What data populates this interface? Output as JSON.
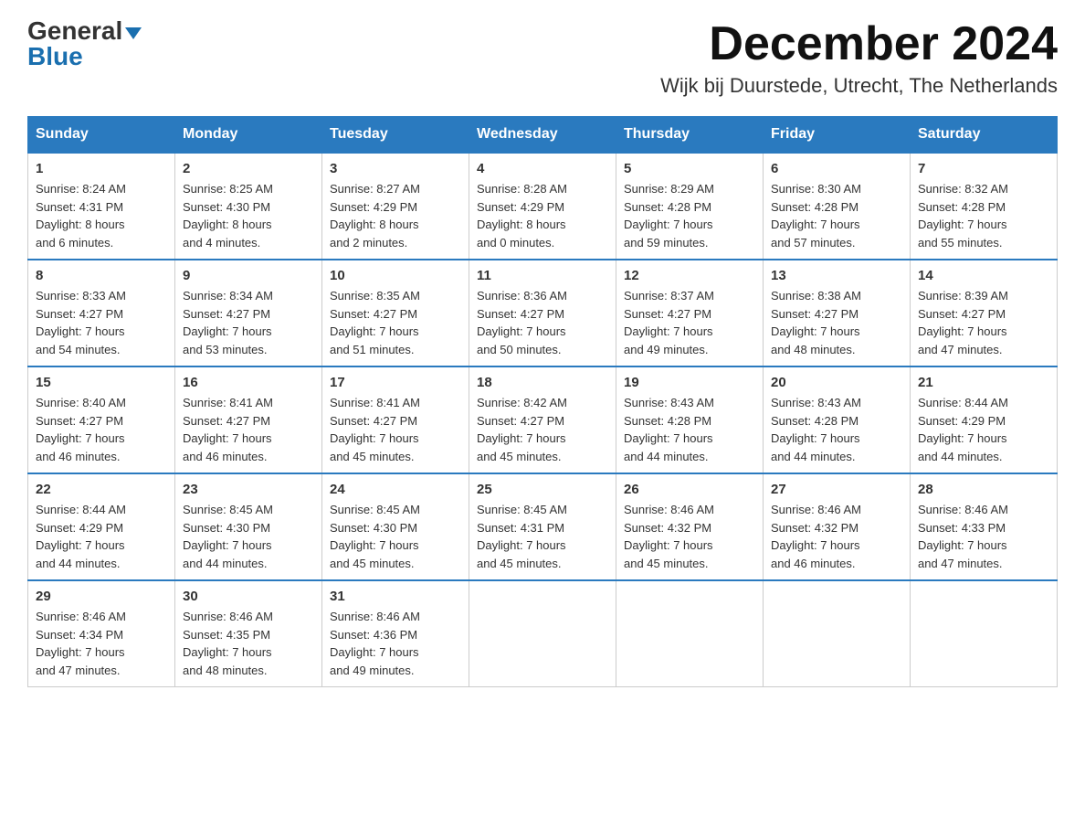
{
  "logo": {
    "general": "General",
    "blue": "Blue"
  },
  "header": {
    "month_year": "December 2024",
    "location": "Wijk bij Duurstede, Utrecht, The Netherlands"
  },
  "weekdays": [
    "Sunday",
    "Monday",
    "Tuesday",
    "Wednesday",
    "Thursday",
    "Friday",
    "Saturday"
  ],
  "weeks": [
    [
      {
        "day": "1",
        "sunrise": "8:24 AM",
        "sunset": "4:31 PM",
        "daylight": "8 hours and 6 minutes."
      },
      {
        "day": "2",
        "sunrise": "8:25 AM",
        "sunset": "4:30 PM",
        "daylight": "8 hours and 4 minutes."
      },
      {
        "day": "3",
        "sunrise": "8:27 AM",
        "sunset": "4:29 PM",
        "daylight": "8 hours and 2 minutes."
      },
      {
        "day": "4",
        "sunrise": "8:28 AM",
        "sunset": "4:29 PM",
        "daylight": "8 hours and 0 minutes."
      },
      {
        "day": "5",
        "sunrise": "8:29 AM",
        "sunset": "4:28 PM",
        "daylight": "7 hours and 59 minutes."
      },
      {
        "day": "6",
        "sunrise": "8:30 AM",
        "sunset": "4:28 PM",
        "daylight": "7 hours and 57 minutes."
      },
      {
        "day": "7",
        "sunrise": "8:32 AM",
        "sunset": "4:28 PM",
        "daylight": "7 hours and 55 minutes."
      }
    ],
    [
      {
        "day": "8",
        "sunrise": "8:33 AM",
        "sunset": "4:27 PM",
        "daylight": "7 hours and 54 minutes."
      },
      {
        "day": "9",
        "sunrise": "8:34 AM",
        "sunset": "4:27 PM",
        "daylight": "7 hours and 53 minutes."
      },
      {
        "day": "10",
        "sunrise": "8:35 AM",
        "sunset": "4:27 PM",
        "daylight": "7 hours and 51 minutes."
      },
      {
        "day": "11",
        "sunrise": "8:36 AM",
        "sunset": "4:27 PM",
        "daylight": "7 hours and 50 minutes."
      },
      {
        "day": "12",
        "sunrise": "8:37 AM",
        "sunset": "4:27 PM",
        "daylight": "7 hours and 49 minutes."
      },
      {
        "day": "13",
        "sunrise": "8:38 AM",
        "sunset": "4:27 PM",
        "daylight": "7 hours and 48 minutes."
      },
      {
        "day": "14",
        "sunrise": "8:39 AM",
        "sunset": "4:27 PM",
        "daylight": "7 hours and 47 minutes."
      }
    ],
    [
      {
        "day": "15",
        "sunrise": "8:40 AM",
        "sunset": "4:27 PM",
        "daylight": "7 hours and 46 minutes."
      },
      {
        "day": "16",
        "sunrise": "8:41 AM",
        "sunset": "4:27 PM",
        "daylight": "7 hours and 46 minutes."
      },
      {
        "day": "17",
        "sunrise": "8:41 AM",
        "sunset": "4:27 PM",
        "daylight": "7 hours and 45 minutes."
      },
      {
        "day": "18",
        "sunrise": "8:42 AM",
        "sunset": "4:27 PM",
        "daylight": "7 hours and 45 minutes."
      },
      {
        "day": "19",
        "sunrise": "8:43 AM",
        "sunset": "4:28 PM",
        "daylight": "7 hours and 44 minutes."
      },
      {
        "day": "20",
        "sunrise": "8:43 AM",
        "sunset": "4:28 PM",
        "daylight": "7 hours and 44 minutes."
      },
      {
        "day": "21",
        "sunrise": "8:44 AM",
        "sunset": "4:29 PM",
        "daylight": "7 hours and 44 minutes."
      }
    ],
    [
      {
        "day": "22",
        "sunrise": "8:44 AM",
        "sunset": "4:29 PM",
        "daylight": "7 hours and 44 minutes."
      },
      {
        "day": "23",
        "sunrise": "8:45 AM",
        "sunset": "4:30 PM",
        "daylight": "7 hours and 44 minutes."
      },
      {
        "day": "24",
        "sunrise": "8:45 AM",
        "sunset": "4:30 PM",
        "daylight": "7 hours and 45 minutes."
      },
      {
        "day": "25",
        "sunrise": "8:45 AM",
        "sunset": "4:31 PM",
        "daylight": "7 hours and 45 minutes."
      },
      {
        "day": "26",
        "sunrise": "8:46 AM",
        "sunset": "4:32 PM",
        "daylight": "7 hours and 45 minutes."
      },
      {
        "day": "27",
        "sunrise": "8:46 AM",
        "sunset": "4:32 PM",
        "daylight": "7 hours and 46 minutes."
      },
      {
        "day": "28",
        "sunrise": "8:46 AM",
        "sunset": "4:33 PM",
        "daylight": "7 hours and 47 minutes."
      }
    ],
    [
      {
        "day": "29",
        "sunrise": "8:46 AM",
        "sunset": "4:34 PM",
        "daylight": "7 hours and 47 minutes."
      },
      {
        "day": "30",
        "sunrise": "8:46 AM",
        "sunset": "4:35 PM",
        "daylight": "7 hours and 48 minutes."
      },
      {
        "day": "31",
        "sunrise": "8:46 AM",
        "sunset": "4:36 PM",
        "daylight": "7 hours and 49 minutes."
      },
      null,
      null,
      null,
      null
    ]
  ],
  "labels": {
    "sunrise": "Sunrise:",
    "sunset": "Sunset:",
    "daylight": "Daylight:"
  }
}
